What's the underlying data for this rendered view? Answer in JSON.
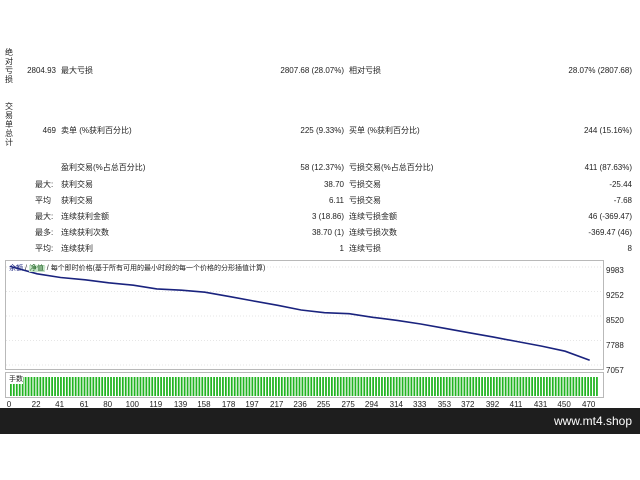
{
  "labels": {
    "abs_dd": "绝对亏损",
    "trades": "交易单总计"
  },
  "row1": {
    "abs_dd_value": "2804.93",
    "max_dd_label": "最大亏损",
    "max_dd_value": "2807.68 (28.07%)",
    "rel_dd_label": "相对亏损",
    "rel_dd_value": "28.07% (2807.68)"
  },
  "row2": {
    "total": "469",
    "short_label": "卖单 (%获利百分比)",
    "short_value": "225 (9.33%)",
    "long_label": "买单 (%获利百分比)",
    "long_value": "244 (15.16%)"
  },
  "row3": {
    "profit_label": "盈利交易(%占总百分比)",
    "profit_value": "58 (12.37%)",
    "loss_label": "亏损交易(%占总百分比)",
    "loss_value": "411 (87.63%)"
  },
  "row4": {
    "prefix": "最大:",
    "left_label": "获利交易",
    "left_value": "38.70",
    "right_label": "亏损交易",
    "right_value": "-25.44"
  },
  "row5": {
    "prefix": "平均",
    "left_label": "获利交易",
    "left_value": "6.11",
    "right_label": "亏损交易",
    "right_value": "-7.68"
  },
  "row6": {
    "prefix": "最大:",
    "left_label": "连续获利金额",
    "left_value": "3 (18.86)",
    "right_label": "连续亏损金额",
    "right_value": "46 (-369.47)"
  },
  "row7": {
    "prefix": "最多:",
    "left_label": "连续获利次数",
    "left_value": "38.70 (1)",
    "right_label": "连续亏损次数",
    "right_value": "-369.47 (46)"
  },
  "row8": {
    "prefix": "平均:",
    "left_label": "连续获利",
    "left_value": "1",
    "right_label": "连续亏损",
    "right_value": "8"
  },
  "chart": {
    "legend_balance": "余额",
    "legend_equity": "净值",
    "caption": "每个即时价格(基于所有可用的最小时段的每一个价格的分形插值计算)",
    "vol_label": "手数",
    "line_color": "#1a237e",
    "vol_color": "#22b422"
  },
  "chart_data": {
    "type": "line",
    "ylim": [
      7057,
      9983
    ],
    "y_ticks": [
      "9983",
      "9252",
      "8520",
      "7788",
      "7057"
    ],
    "x_ticks": [
      "0",
      "22",
      "41",
      "61",
      "80",
      "100",
      "119",
      "139",
      "158",
      "178",
      "197",
      "217",
      "236",
      "255",
      "275",
      "294",
      "314",
      "333",
      "353",
      "372",
      "392",
      "411",
      "431",
      "450",
      "470"
    ],
    "x": [
      0,
      22,
      41,
      61,
      80,
      100,
      119,
      139,
      158,
      178,
      197,
      217,
      236,
      255,
      275,
      294,
      314,
      333,
      353,
      372,
      392,
      411,
      431,
      450,
      470
    ],
    "series": [
      {
        "values": [
          10000,
          9780,
          9670,
          9600,
          9510,
          9440,
          9330,
          9290,
          9230,
          9100,
          8970,
          8840,
          8700,
          8620,
          8590,
          8480,
          8390,
          8280,
          8150,
          8020,
          7890,
          7760,
          7620,
          7470,
          7200
        ]
      }
    ]
  },
  "footer": {
    "watermark": "www.mt4.shop"
  }
}
